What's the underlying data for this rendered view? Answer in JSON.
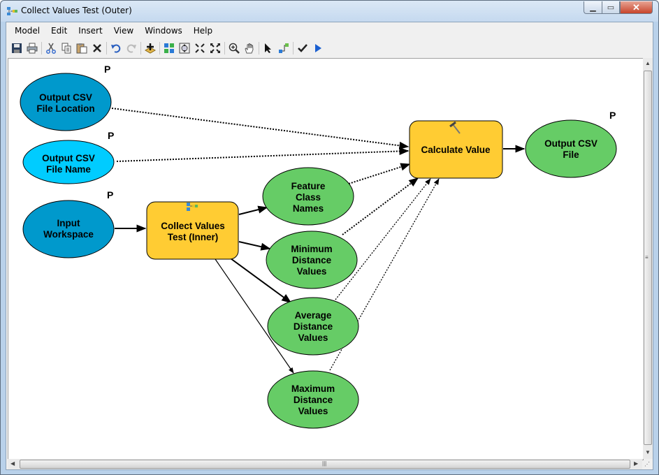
{
  "window": {
    "title": "Collect Values Test (Outer)",
    "min_icon": "minimize-icon",
    "max_icon": "maximize-icon",
    "close_icon": "close-icon"
  },
  "menu": [
    "Model",
    "Edit",
    "Insert",
    "View",
    "Windows",
    "Help"
  ],
  "toolbar": [
    "save-icon",
    "print-icon",
    "cut-icon",
    "copy-icon",
    "paste-icon",
    "delete-icon",
    "undo-icon",
    "redo-icon",
    "add-data-icon",
    "auto-layout-icon",
    "full-extent-icon",
    "zoom-in-fixed-icon",
    "zoom-out-fixed-icon",
    "zoom-in-icon",
    "pan-icon",
    "select-icon",
    "connect-icon",
    "validate-icon",
    "run-icon"
  ],
  "colors": {
    "param_dark": "#0099cc",
    "param_light": "#00ccff",
    "tool": "#ffcc33",
    "derived": "#66cc66"
  },
  "diagram": {
    "param_marker": "P",
    "nodes": {
      "output_csv_location": [
        "Output CSV",
        "File Location"
      ],
      "output_csv_name": [
        "Output CSV",
        "File Name"
      ],
      "input_workspace": [
        "Input",
        "Workspace"
      ],
      "collect_values": [
        "Collect Values",
        "Test (Inner)"
      ],
      "feature_class_names": [
        "Feature",
        "Class",
        "Names"
      ],
      "min_distance": [
        "Minimum",
        "Distance",
        "Values"
      ],
      "avg_distance": [
        "Average",
        "Distance",
        "Values"
      ],
      "max_distance": [
        "Maximum",
        "Distance",
        "Values"
      ],
      "calculate_value": [
        "Calculate Value"
      ],
      "output_csv_file": [
        "Output CSV",
        "File"
      ]
    }
  }
}
